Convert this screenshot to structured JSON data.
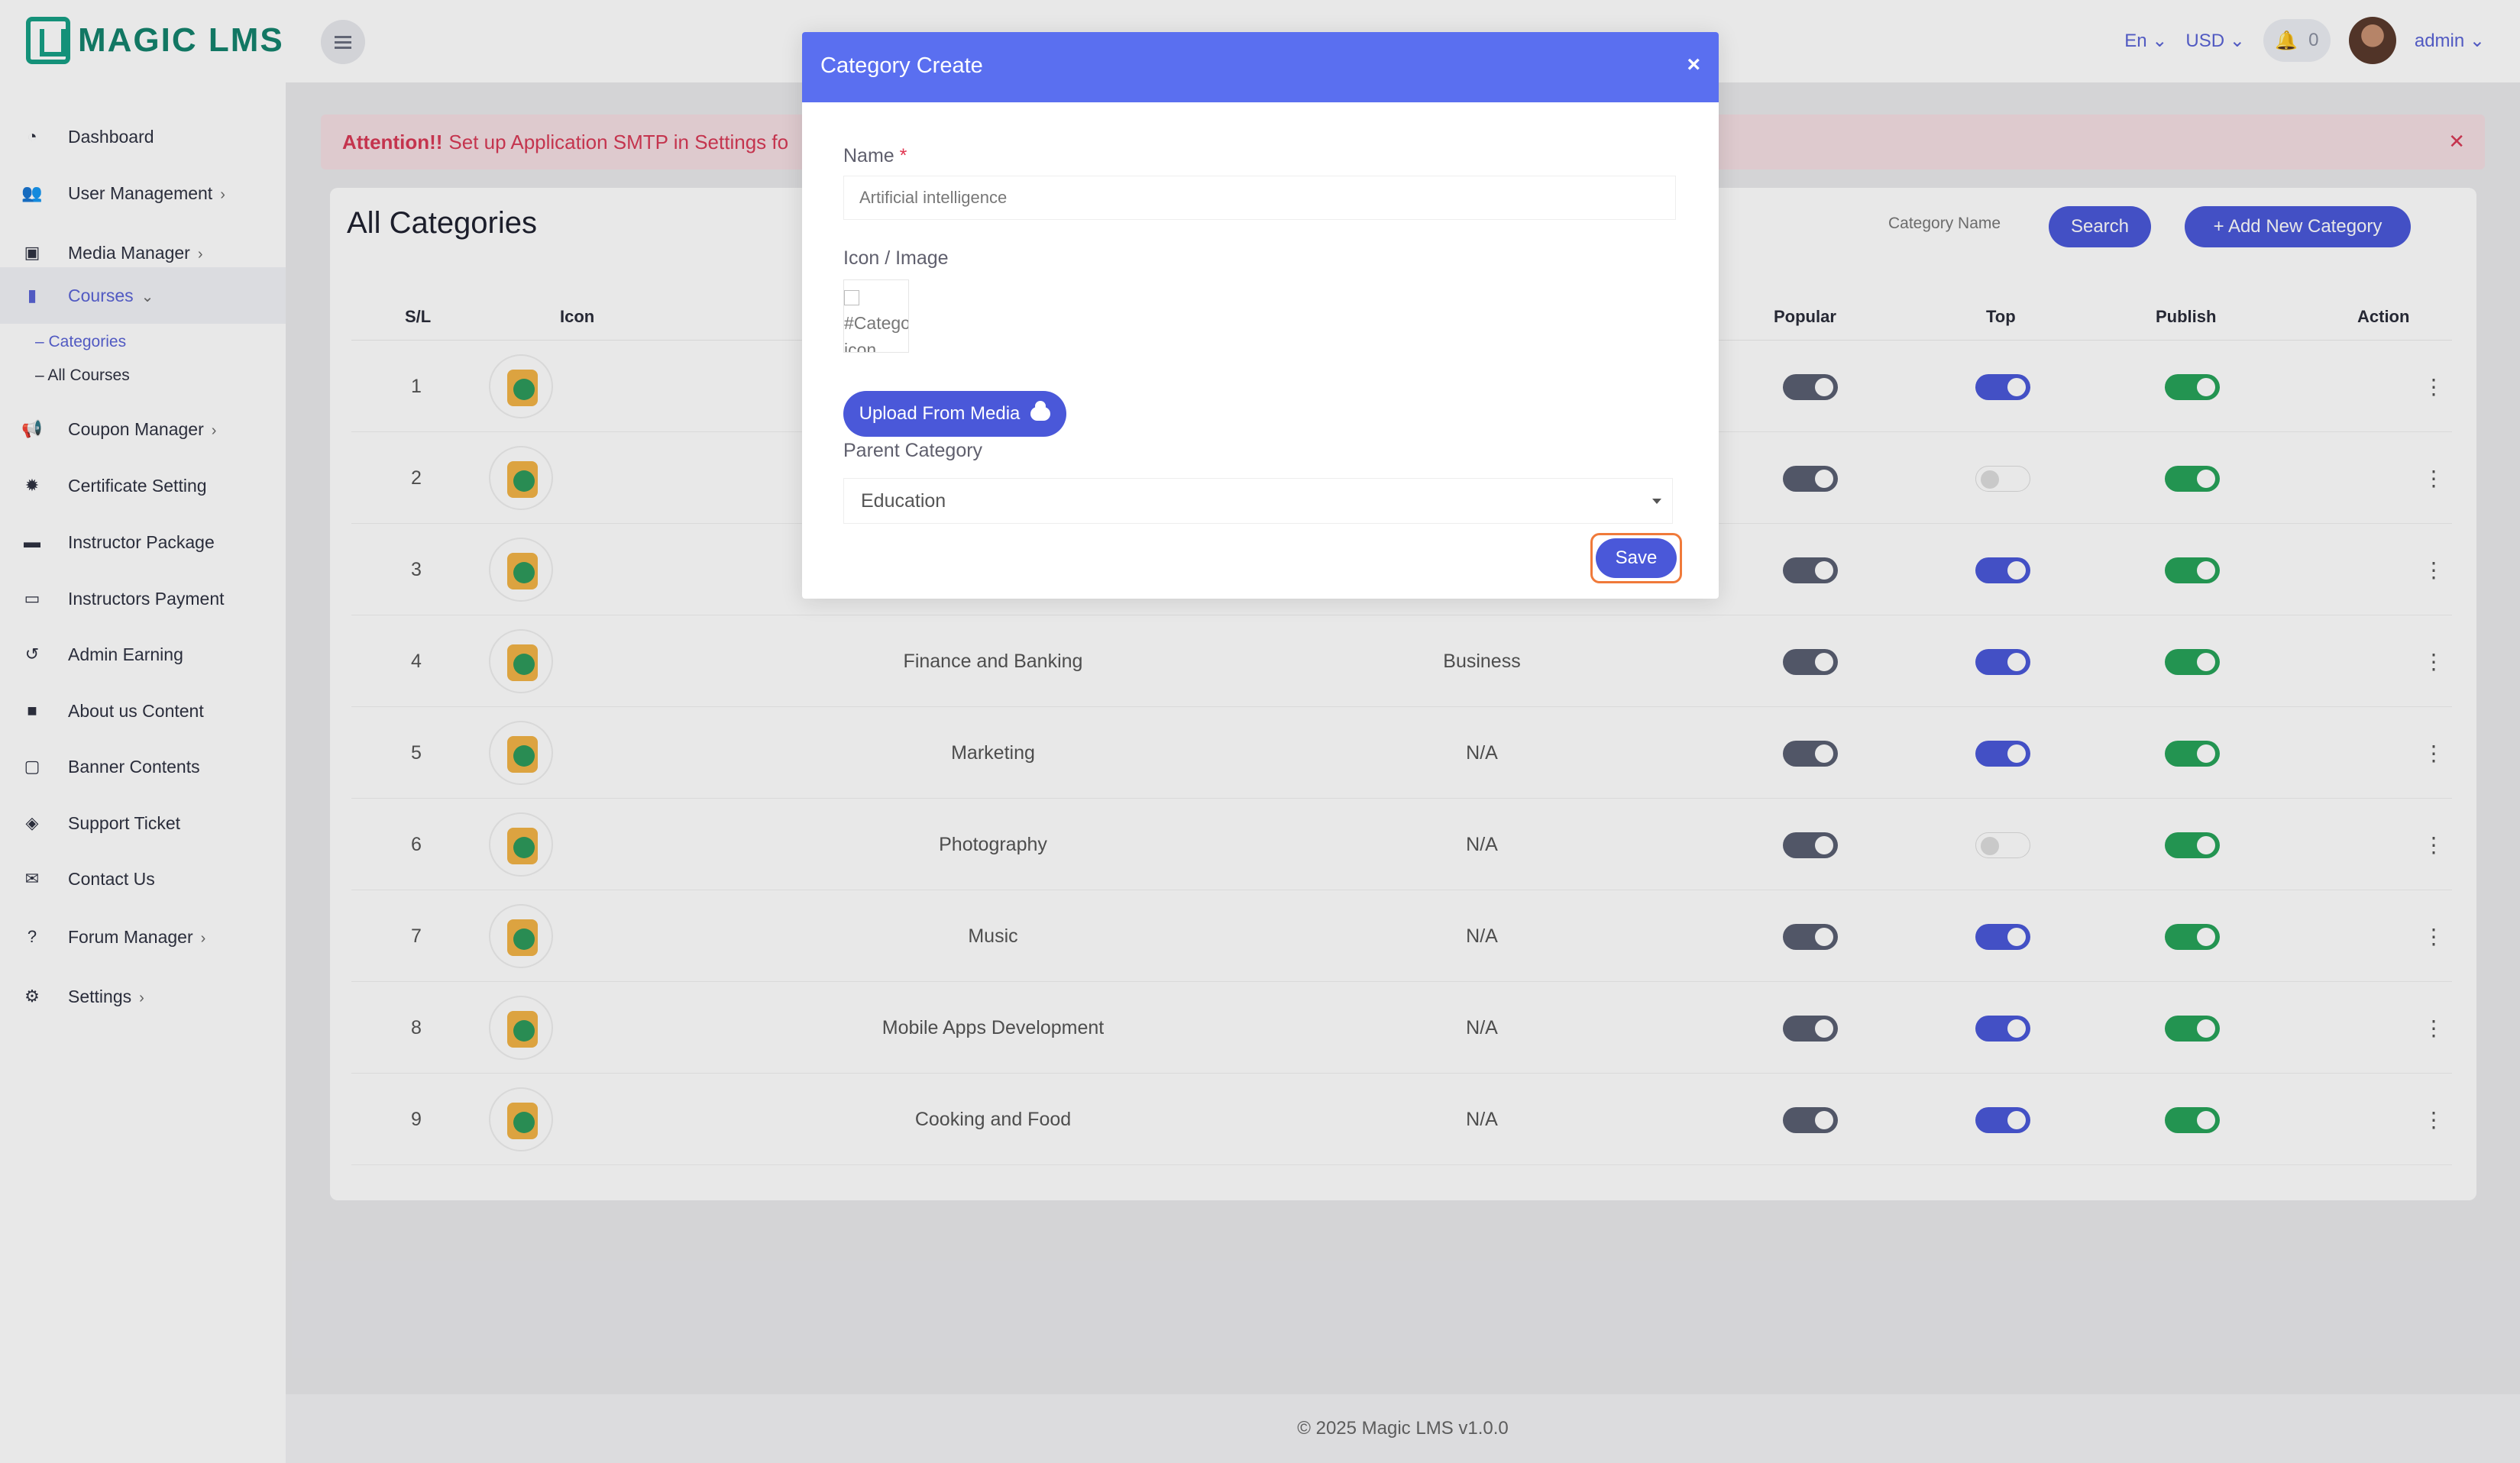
{
  "app": {
    "logo_text": "MAGIC LMS"
  },
  "topbar": {
    "language": "En",
    "currency": "USD",
    "notifications_count": "0",
    "user_name": "admin"
  },
  "sidebar": {
    "items": [
      {
        "label": "Dashboard",
        "icon": "dashboard-icon"
      },
      {
        "label": "User Management",
        "icon": "users-icon",
        "has_submenu": true
      },
      {
        "label": "Media Manager",
        "icon": "image-icon",
        "has_submenu": true
      },
      {
        "label": "Courses",
        "icon": "book-icon",
        "expanded": true
      },
      {
        "label": "Coupon Manager",
        "icon": "megaphone-icon",
        "has_submenu": true
      },
      {
        "label": "Certificate Setting",
        "icon": "certificate-icon"
      },
      {
        "label": "Instructor Package",
        "icon": "briefcase-icon"
      },
      {
        "label": "Instructors Payment",
        "icon": "money-icon"
      },
      {
        "label": "Admin Earning",
        "icon": "history-icon"
      },
      {
        "label": "About us Content",
        "icon": "note-icon"
      },
      {
        "label": "Banner Contents",
        "icon": "banner-icon"
      },
      {
        "label": "Support Ticket",
        "icon": "ticket-icon"
      },
      {
        "label": "Contact Us",
        "icon": "envelope-icon"
      },
      {
        "label": "Forum Manager",
        "icon": "question-icon",
        "has_submenu": true
      },
      {
        "label": "Settings",
        "icon": "gear-icon",
        "has_submenu": true
      }
    ],
    "courses_sub": [
      {
        "label": "– Categories"
      },
      {
        "label": "– All Courses"
      }
    ]
  },
  "alert": {
    "strong": "Attention!!",
    "text": "Set up Application SMTP in Settings fo"
  },
  "categories": {
    "title": "All Categories",
    "search_label": "Category Name",
    "search_button": "Search",
    "add_button": "+ Add New Category",
    "headers": [
      "S/L",
      "Icon",
      "Popular",
      "Top",
      "Publish",
      "Action"
    ],
    "rows": [
      {
        "sl": "1",
        "name": "",
        "parent": "",
        "top": true
      },
      {
        "sl": "2",
        "name": "",
        "parent": "",
        "top": false
      },
      {
        "sl": "3",
        "name": "",
        "parent": "",
        "top": true
      },
      {
        "sl": "4",
        "name": "Finance and Banking",
        "parent": "Business",
        "top": true
      },
      {
        "sl": "5",
        "name": "Marketing",
        "parent": "N/A",
        "top": true
      },
      {
        "sl": "6",
        "name": "Photography",
        "parent": "N/A",
        "top": false
      },
      {
        "sl": "7",
        "name": "Music",
        "parent": "N/A",
        "top": true
      },
      {
        "sl": "8",
        "name": "Mobile Apps Development",
        "parent": "N/A",
        "top": true
      },
      {
        "sl": "9",
        "name": "Cooking and Food",
        "parent": "N/A",
        "top": true
      }
    ]
  },
  "modal": {
    "title": "Category Create",
    "close": "×",
    "name_label": "Name",
    "required_mark": "*",
    "name_value": "Artificial intelligence",
    "icon_label": "Icon / Image",
    "broken_img_alt": "#Category icon",
    "upload_button": "Upload From Media",
    "parent_label": "Parent Category",
    "parent_value": "Education",
    "save_button": "Save"
  },
  "footer": {
    "text": "© 2025 Magic LMS v1.0.0"
  },
  "colors": {
    "primary": "#4a58d9",
    "modal_header": "#5a6ff0",
    "toggle_gray": "#5a5f72",
    "toggle_blue": "#4a58d9",
    "toggle_green": "#27a35a",
    "logo_green": "#16a085",
    "alert_text": "#d83a56"
  }
}
